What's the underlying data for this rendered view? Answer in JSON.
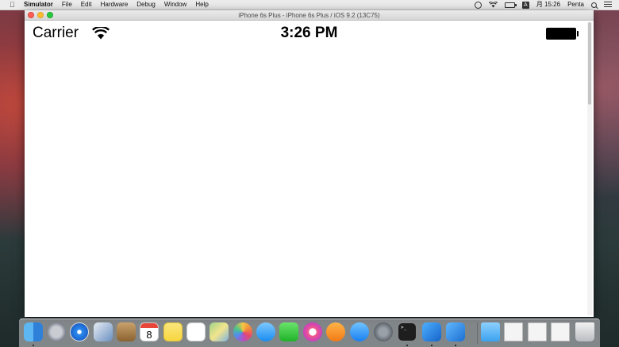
{
  "menubar": {
    "app_name": "Simulator",
    "items": [
      "File",
      "Edit",
      "Hardware",
      "Debug",
      "Window",
      "Help"
    ],
    "status_icons": [
      "time-machine-icon",
      "wifi-icon",
      "battery-icon",
      "input-source-icon"
    ],
    "input_source_label": "A",
    "date_time": "月 15:26",
    "user": "Penta"
  },
  "window": {
    "title": "iPhone 6s Plus - iPhone 6s Plus / iOS 9.2 (13C75)"
  },
  "device": {
    "carrier": "Carrier",
    "time": "3:26 PM"
  },
  "dock": {
    "calendar_day": "8",
    "icons": [
      "finder-icon",
      "launchpad-icon",
      "safari-icon",
      "mail-icon",
      "contacts-icon",
      "calendar-icon",
      "notes-icon",
      "reminders-icon",
      "maps-icon",
      "photos-icon",
      "messages-icon",
      "facetime-icon",
      "itunes-icon",
      "ibooks-icon",
      "app-store-icon",
      "system-preferences-icon",
      "terminal-icon",
      "xcode-icon",
      "instruments-icon",
      "downloads-folder-icon",
      "screenshot-doc-icon",
      "screenshot-doc-icon-2",
      "screenshot-doc-icon-3",
      "trash-icon"
    ]
  }
}
